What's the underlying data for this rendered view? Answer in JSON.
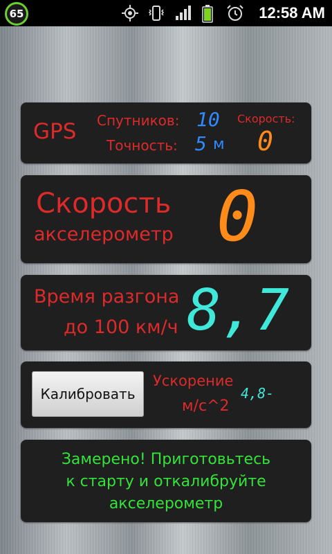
{
  "status_bar": {
    "badge": "65",
    "time": "12:58 AM",
    "icons": [
      "gps-icon",
      "vibrate-icon",
      "signal-icon",
      "battery-icon",
      "alarm-icon"
    ]
  },
  "gps_panel": {
    "title": "GPS",
    "satellites_label": "Спутников:",
    "satellites_value": "10",
    "accuracy_label": "Точность:",
    "accuracy_value": "5",
    "accuracy_unit": "м",
    "speed_label": "Скорость:",
    "speed_value": "0"
  },
  "accel_speed_panel": {
    "title": "Скорость",
    "subtitle": "акселерометр",
    "value": "0"
  },
  "time_panel": {
    "line1": "Время разгона",
    "line2": "до 100 км/ч",
    "value": "8,7"
  },
  "calibration_panel": {
    "button_label": "Калибровать",
    "accel_label": "Ускорение",
    "accel_unit": "м/с^2",
    "accel_value": "4,8-"
  },
  "message_panel": {
    "line1": "Замерено! Приготовьтесь",
    "line2": "к старту и откалибруйте",
    "line3": "акселерометр"
  },
  "colors": {
    "red": "#dd2a2a",
    "orange": "#ff8c1a",
    "blue": "#2f8bff",
    "cyan": "#3fe8d8",
    "green": "#34e23a"
  }
}
